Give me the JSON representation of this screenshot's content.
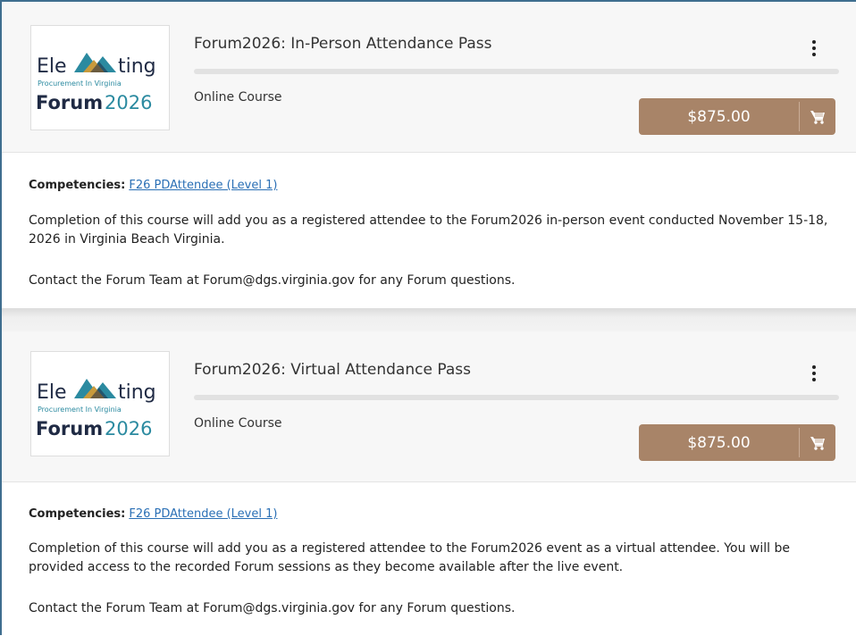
{
  "courses": [
    {
      "logo": {
        "line1": "Ele",
        "line1b": "ting",
        "line2": "Procurement In Virginia",
        "line3a": "Forum",
        "line3b": "2026"
      },
      "title": "Forum2026: In-Person Attendance Pass",
      "type": "Online Course",
      "price": "$875.00",
      "competencies_label": "Competencies:",
      "competency_link": "F26 PDAttendee (Level 1)",
      "description": "Completion of this course will add you as a registered attendee to the Forum2026 in-person event conducted November 15-18, 2026 in Virginia Beach Virginia.",
      "contact": "Contact the Forum Team at Forum@dgs.virginia.gov for any Forum questions."
    },
    {
      "logo": {
        "line1": "Ele",
        "line1b": "ting",
        "line2": "Procurement In Virginia",
        "line3a": "Forum",
        "line3b": "2026"
      },
      "title": "Forum2026: Virtual Attendance Pass",
      "type": "Online Course",
      "price": "$875.00",
      "competencies_label": "Competencies:",
      "competency_link": "F26 PDAttendee (Level 1)",
      "description": "Completion of this course will add you as a registered attendee to the Forum2026 event as a virtual attendee.  You will be provided access to the recorded Forum sessions as they become available after the live event.",
      "contact": "Contact the Forum Team at Forum@dgs.virginia.gov for any Forum questions."
    }
  ],
  "colors": {
    "price_button": "#a88468",
    "link": "#2a6fb5",
    "logo_navy": "#1f2a44",
    "logo_teal": "#2b8aa0",
    "logo_gold": "#c89a3c"
  },
  "icons": {
    "menu": "kebab-menu-icon",
    "cart": "shopping-cart-icon"
  }
}
